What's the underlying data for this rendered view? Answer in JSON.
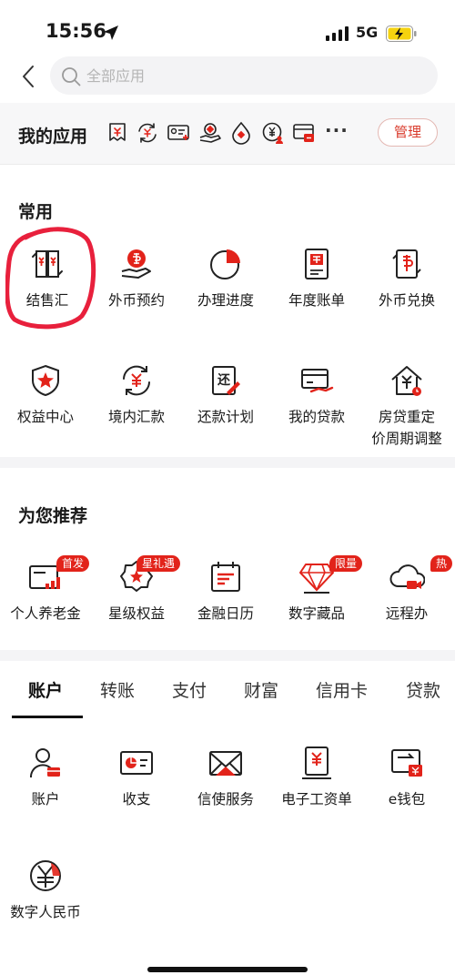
{
  "status_bar": {
    "time": "15:56",
    "network": "5G",
    "icons": [
      "location-arrow-icon",
      "signal-icon",
      "battery-charging-icon"
    ]
  },
  "search": {
    "placeholder": "全部应用"
  },
  "my_apps": {
    "title": "我的应用",
    "mini_icons": [
      "bill-down-icon",
      "exchange-cycle-icon",
      "id-card-icon",
      "hand-coin-icon",
      "drop-coin-icon",
      "yuan-person-icon",
      "card-cash-icon"
    ],
    "more": "···",
    "manage_label": "管理"
  },
  "common": {
    "title": "常用",
    "items": [
      {
        "label": "结售汇",
        "icon": "exchange-settlement-icon"
      },
      {
        "label": "外币预约",
        "icon": "foreign-currency-hand-icon"
      },
      {
        "label": "办理进度",
        "icon": "pie-progress-icon"
      },
      {
        "label": "年度账单",
        "icon": "annual-bill-icon"
      },
      {
        "label": "外币兑换",
        "icon": "currency-exchange-icon"
      },
      {
        "label": "权益中心",
        "icon": "shield-star-icon"
      },
      {
        "label": "境内汇款",
        "icon": "domestic-transfer-icon"
      },
      {
        "label": "还款计划",
        "icon": "repay-plan-icon"
      },
      {
        "label": "我的贷款",
        "icon": "loan-card-icon"
      },
      {
        "label": "房贷重定",
        "label2": "价周期调整",
        "icon": "house-loan-icon"
      }
    ]
  },
  "recommend": {
    "title": "为您推荐",
    "items": [
      {
        "label": "个人养老金",
        "badge": "首发",
        "icon": "pension-chart-icon"
      },
      {
        "label": "星级权益",
        "badge": "星礼遇",
        "icon": "star-ribbon-icon"
      },
      {
        "label": "金融日历",
        "badge": "",
        "icon": "calendar-icon"
      },
      {
        "label": "数字藏品",
        "badge": "限量",
        "icon": "diamond-icon"
      },
      {
        "label": "远程办",
        "badge": "热",
        "icon": "cloud-video-icon"
      }
    ]
  },
  "tabs": {
    "items": [
      "账户",
      "转账",
      "支付",
      "财富",
      "信用卡",
      "贷款"
    ],
    "active": "账户"
  },
  "account": {
    "items": [
      {
        "label": "账户",
        "icon": "user-card-icon"
      },
      {
        "label": "收支",
        "icon": "income-expense-icon"
      },
      {
        "label": "信使服务",
        "icon": "envelope-icon"
      },
      {
        "label": "电子工资单",
        "icon": "payslip-icon"
      },
      {
        "label": "e钱包",
        "icon": "wallet-icon"
      },
      {
        "label": "数字人民币",
        "icon": "digital-rmb-icon"
      }
    ]
  },
  "colors": {
    "accent": "#e2231a",
    "manage_border": "#e4b8b3",
    "section_bg": "#f4f4f6",
    "annotation_circle": "#e8203c"
  }
}
